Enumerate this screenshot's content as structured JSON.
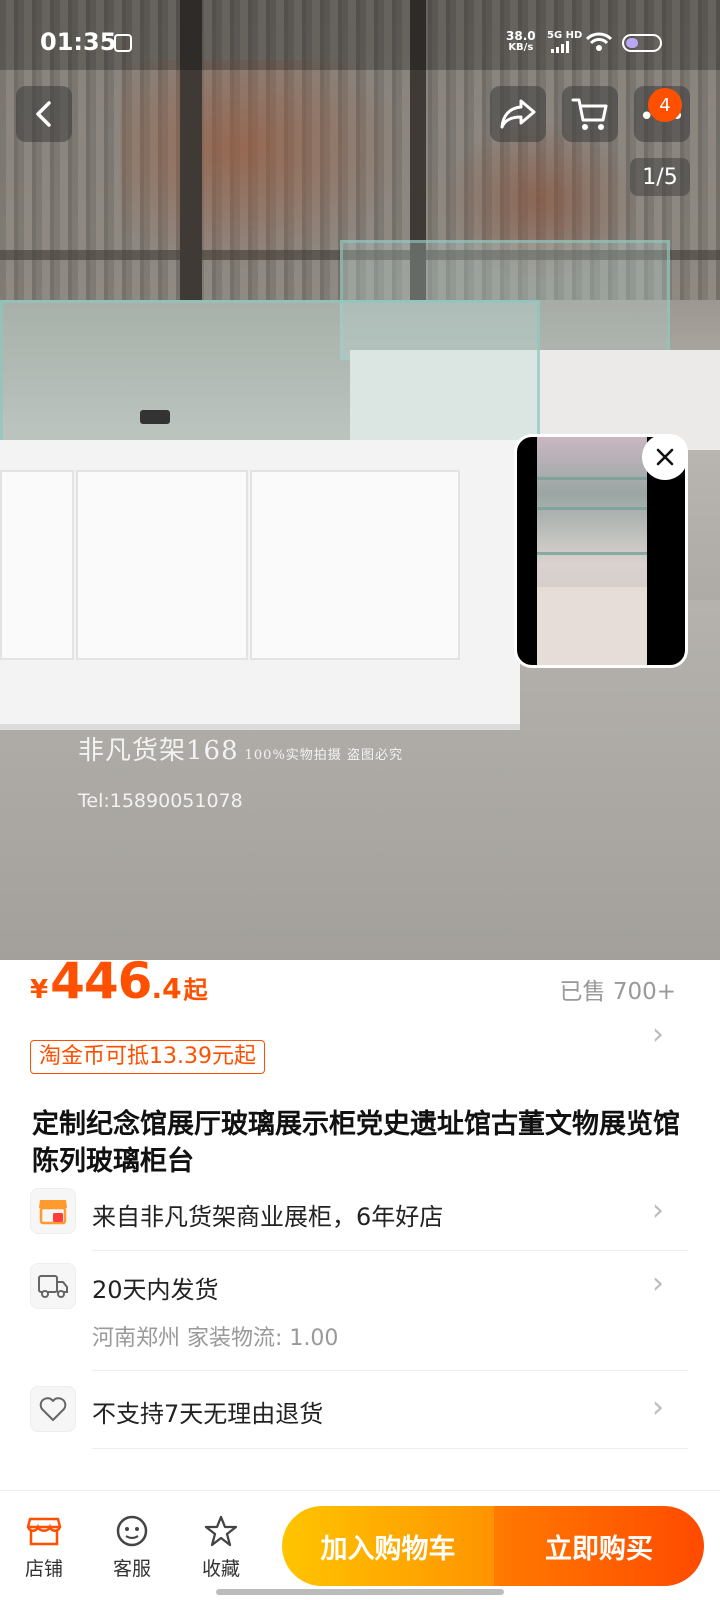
{
  "status_bar": {
    "time": "01:35",
    "net_speed_value": "38.0",
    "net_speed_unit": "KB/s",
    "signal_label": "5G HD"
  },
  "header": {
    "cart_badge": "4",
    "image_counter": "1/5"
  },
  "image": {
    "watermark_name": "非凡货架168",
    "watermark_note": "100%实物拍摄 盗图必究",
    "watermark_tel": "Tel:15890051078"
  },
  "product": {
    "currency": "¥",
    "price_int": "446",
    "price_dec": ".4",
    "price_suffix": "起",
    "sold": "已售 700+",
    "coin_discount": "淘金币可抵13.39元起",
    "title": "定制纪念馆展厅玻璃展示柜党史遗址馆古董文物展览馆陈列玻璃柜台"
  },
  "info_rows": {
    "shop": "来自非凡货架商业展柜，6年好店",
    "shipping": "20天内发货",
    "shipping_detail": "河南郑州  家装物流: 1.00",
    "returns": "不支持7天无理由退货"
  },
  "bottom_bar": {
    "tab_shop": "店铺",
    "tab_service": "客服",
    "tab_favorite": "收藏",
    "add_to_cart": "加入购物车",
    "buy_now": "立即购买"
  },
  "colors": {
    "accent": "#ff5000",
    "cart_button": "#ffb300",
    "buy_button": "#ff5a00"
  },
  "icons": [
    "back-icon",
    "share-icon",
    "cart-icon",
    "more-icon",
    "close-icon",
    "shop-icon",
    "truck-icon",
    "heart-icon",
    "service-icon",
    "star-icon",
    "chevron-right-icon"
  ]
}
